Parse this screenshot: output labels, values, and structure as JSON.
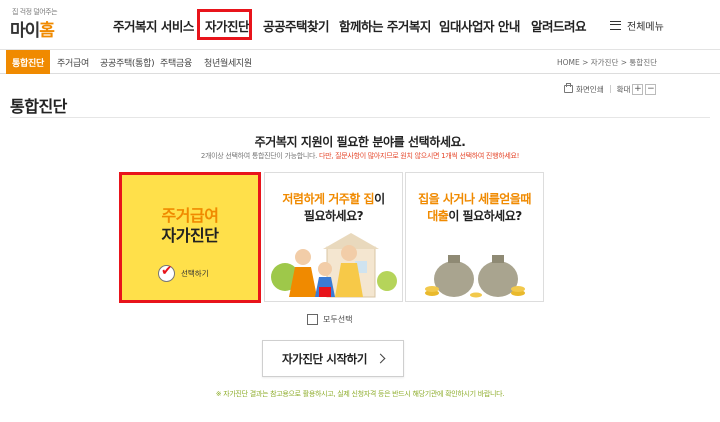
{
  "logo": {
    "tagline": "집 걱정 덜어주는",
    "name_a": "마이",
    "name_b": "홈"
  },
  "gnb": {
    "items": [
      "주거복지 서비스",
      "자가진단",
      "공공주택찾기",
      "함께하는 주거복지",
      "임대사업자 안내",
      "알려드려요"
    ],
    "all_menu": "전체메뉴"
  },
  "subnav": {
    "items": [
      "통합진단",
      "주거급여",
      "공공주택(통합)",
      "주택금융",
      "청년월세지원"
    ],
    "breadcrumb": "HOME > 자가진단 > 통합진단"
  },
  "page": {
    "title": "통합진단",
    "print": "화면인쇄",
    "zoom": "확대",
    "zoom_in": "+",
    "zoom_out": "−"
  },
  "question": {
    "title": "주거복지 지원이 필요한 분야를 선택하세요.",
    "notice_a": "2개이상 선택하여 통합진단이 가능합니다.",
    "notice_b": "다만, 질문사항이 많아지므로 원치 않으시면 1개씩 선택하여 진행하세요!"
  },
  "cards": {
    "card1": {
      "line1": "주거급여",
      "line2": "자가진단",
      "check": "선택하기"
    },
    "card2": {
      "l1a": "저렴하게 거주할 ",
      "l1b": "집",
      "l1c": "이",
      "l2": "필요하세요?"
    },
    "card3": {
      "l1a": "집을 사거나 세를얻을때",
      "l2a": "대출",
      "l2b": "이 필요하세요?"
    }
  },
  "select_all": "모두선택",
  "start_button": "자가진단 시작하기",
  "foot_note": "※ 자가진단 결과는 참고용으로 활용하시고, 실제 신청자격 등은 반드시 해당기관에 확인하시기 바랍니다.",
  "colors": {
    "accent": "#f08a00",
    "highlight": "#e8141b",
    "card_yellow": "#ffe04a"
  }
}
